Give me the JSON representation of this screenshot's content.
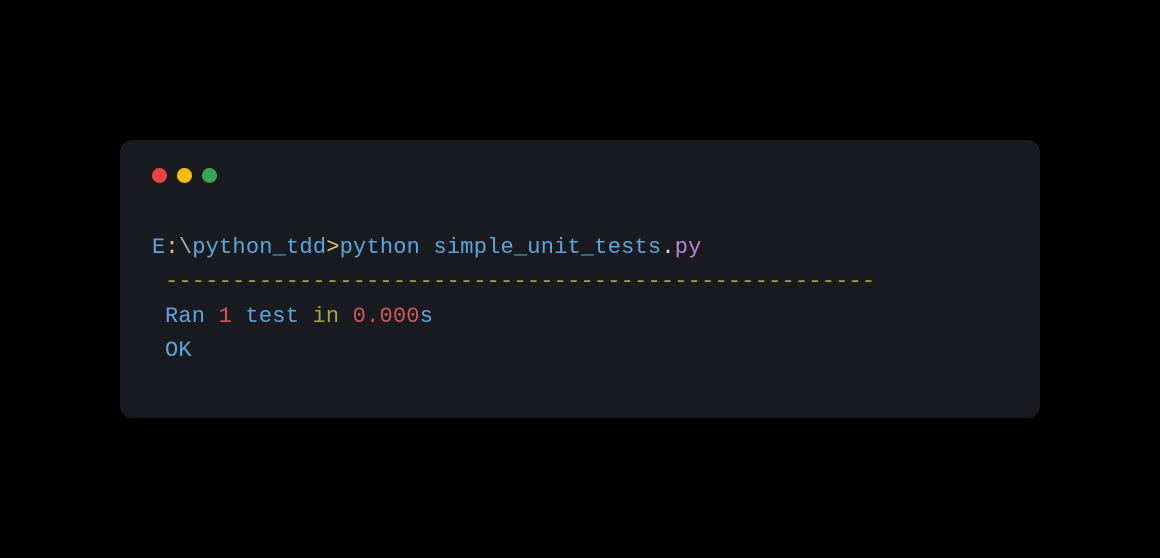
{
  "titlebar": {
    "close_color": "#ed4245",
    "minimize_color": "#f6be00",
    "maximize_color": "#3aa655"
  },
  "prompt": {
    "drive": "E",
    "colon": ":",
    "backslash": "\\",
    "directory": "python_tdd",
    "gt": ">",
    "command": "python",
    "space": " ",
    "filename": "simple_unit_tests",
    "dot": ".",
    "extension": "py"
  },
  "output": {
    "separator": "-----------------------------------------------------",
    "ran": "Ran",
    "count": "1",
    "test_word": "test",
    "in_word": "in",
    "duration": "0.000",
    "unit": "s",
    "status": "OK"
  }
}
